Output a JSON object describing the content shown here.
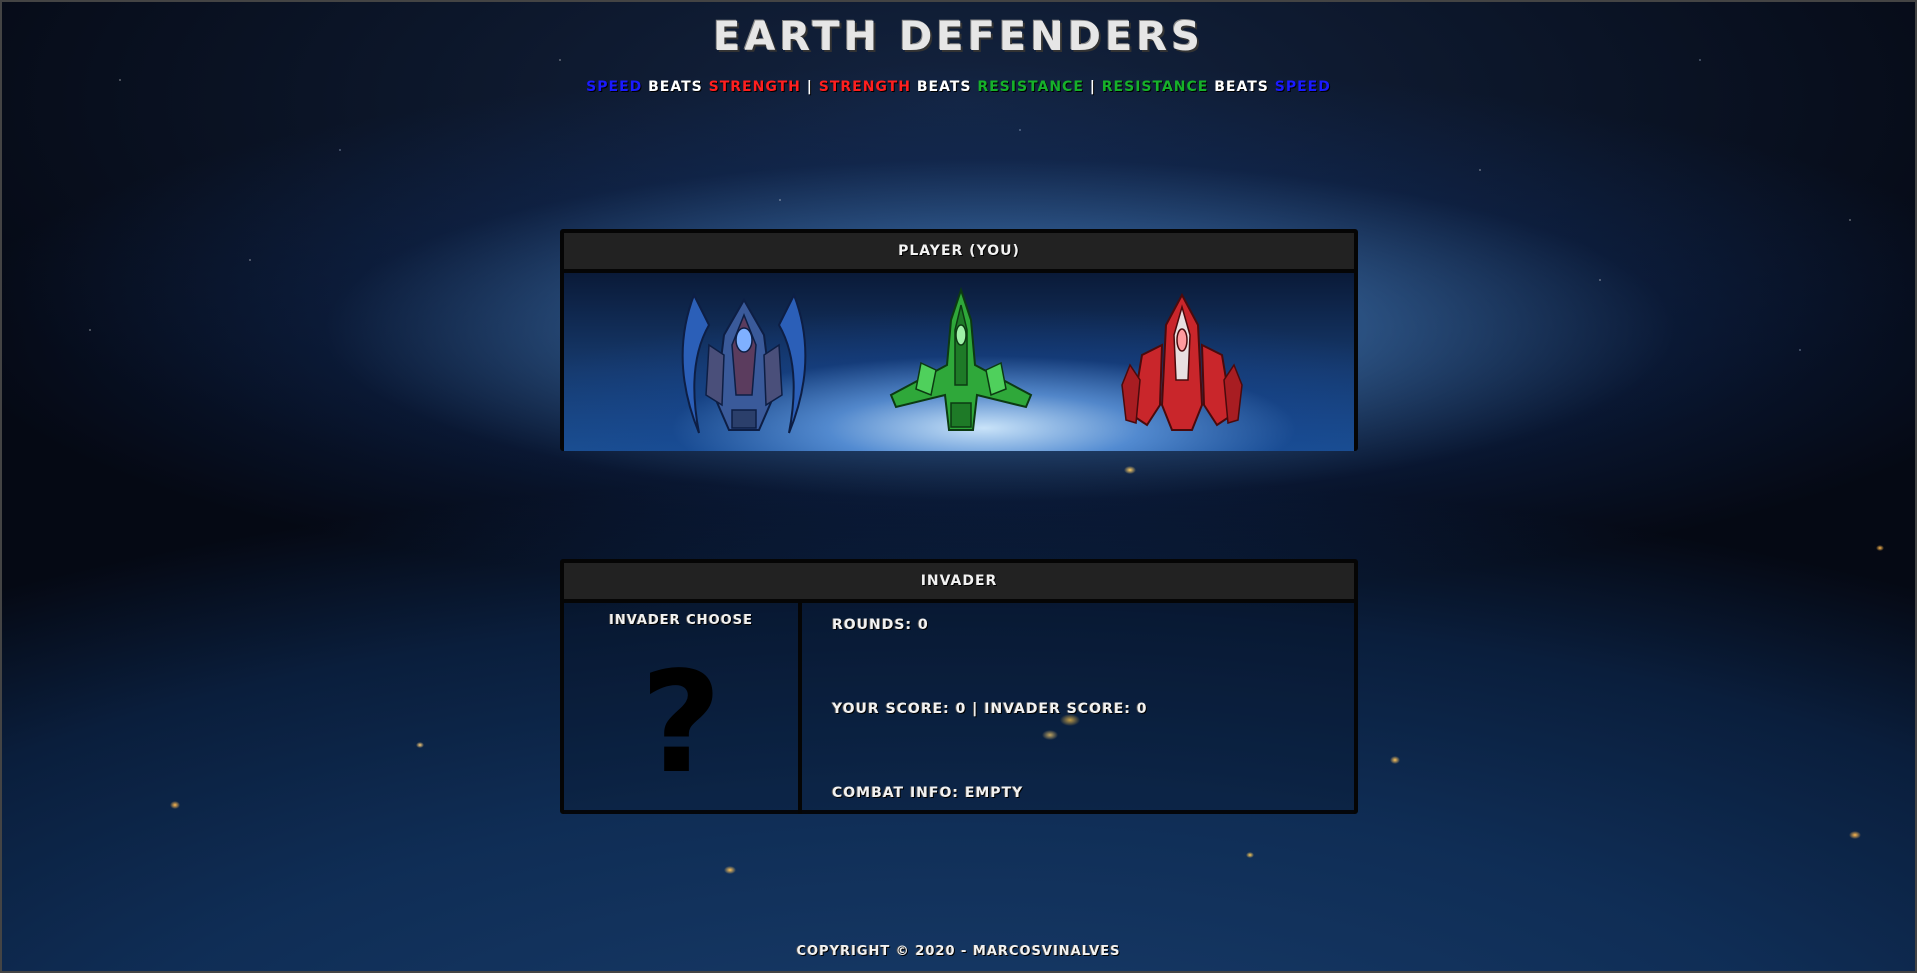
{
  "game": {
    "title": "EARTH DEFENDERS",
    "rules": {
      "segments": [
        {
          "text": "SPEED",
          "class": "speed"
        },
        {
          "text": "BEATS",
          "class": "beats"
        },
        {
          "text": "STRENGTH",
          "class": "strength"
        },
        {
          "text": "|",
          "class": "sep"
        },
        {
          "text": "STRENGTH",
          "class": "strength"
        },
        {
          "text": "BEATS",
          "class": "beats"
        },
        {
          "text": "RESISTANCE",
          "class": "resistance"
        },
        {
          "text": "|",
          "class": "sep"
        },
        {
          "text": "RESISTANCE",
          "class": "resistance"
        },
        {
          "text": "BEATS",
          "class": "beats"
        },
        {
          "text": "SPEED",
          "class": "speed"
        }
      ]
    }
  },
  "player_panel": {
    "header": "PLAYER (YOU)",
    "ships": [
      {
        "id": "speed",
        "icon": "blue-spaceship-icon",
        "color": "#2b5fb8"
      },
      {
        "id": "resistance",
        "icon": "green-spaceship-icon",
        "color": "#2fa83a"
      },
      {
        "id": "strength",
        "icon": "red-spaceship-icon",
        "color": "#c9262b"
      }
    ]
  },
  "invader_panel": {
    "header": "INVADER",
    "choice_label": "INVADER CHOOSE",
    "choice_symbol": "?",
    "rounds": "ROUNDS: 0",
    "score": "YOUR SCORE: 0 | INVADER SCORE: 0",
    "combat_info": "COMBAT INFO: EMPTY"
  },
  "footer": {
    "copyright": "COPYRIGHT © 2020 - MARCOSVINALVES"
  },
  "colors": {
    "speed": "#1a1aff",
    "strength": "#ff1f1f",
    "resistance": "#16b12a",
    "panel_border": "#050505",
    "panel_header_bg": "#222222"
  }
}
